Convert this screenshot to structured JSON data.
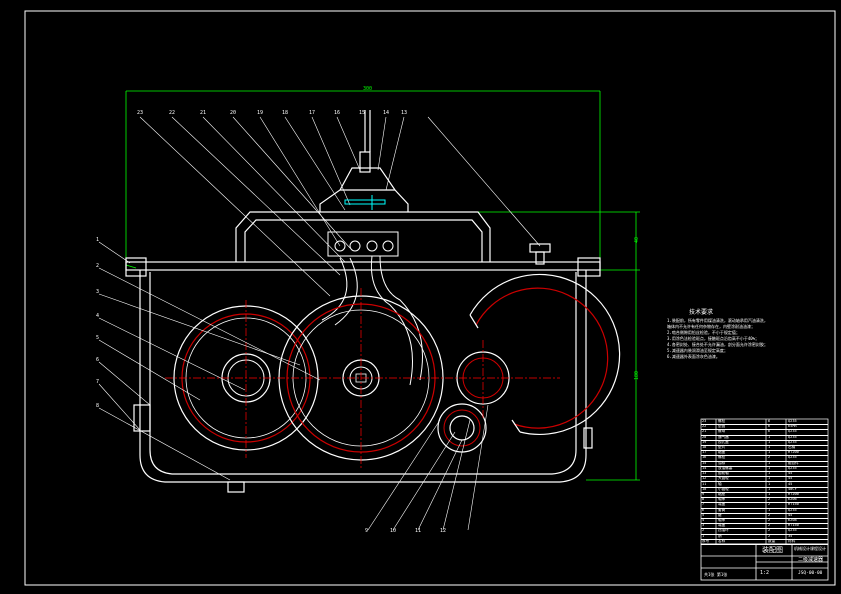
{
  "drawing": {
    "colors": {
      "background": "#000000",
      "outline": "#ffffff",
      "dimension": "#00ff00",
      "centerline": "#ff0000",
      "gear_pitch": "#cc0000",
      "leader": "#ffffff",
      "accent": "#00ffff",
      "hatch": "#ff00ff"
    },
    "top_dimension": "300",
    "right_dimensions": [
      "40",
      "180"
    ],
    "top_balloons": [
      "23",
      "22",
      "21",
      "20",
      "19",
      "18",
      "17",
      "16",
      "15",
      "14",
      "13"
    ],
    "left_balloons": [
      "1",
      "2",
      "3",
      "4",
      "5",
      "6",
      "7",
      "8"
    ],
    "bottom_balloons": [
      "9",
      "10",
      "11",
      "12"
    ],
    "technical_requirements": {
      "title": "技术要求",
      "lines": [
        "1.装配前，所有零件用煤油清洗，滚动轴承用汽油清洗，",
        "  箱体内不允许有任何杂物存在，内壁涂耐油油漆；",
        "2.啮合侧隙用铅丝检验，不小于规定值；",
        "3.用涂色法检验斑点，接触斑点沿齿高不小于40%；",
        "4.各密封处、接合处不允许漏油，剖分面允许涂密封胶；",
        "5.减速器内装润滑油至规定高度；",
        "6.减速器外表面涂灰色油漆。"
      ]
    },
    "title_block": {
      "drawing_name": "装配图",
      "company": "机械设计课程设计",
      "part_name": "二级减速器",
      "drawing_no": "JSQ-00-00",
      "scale": "1:2",
      "sheet": "共1张 第1张"
    },
    "parts_list": {
      "rows": [
        [
          "23",
          "螺栓",
          "6",
          "Q235"
        ],
        [
          "22",
          "垫圈",
          "6",
          "65Mn"
        ],
        [
          "21",
          "螺母",
          "6",
          "Q235"
        ],
        [
          "20",
          "通气器",
          "1",
          "Q235"
        ],
        [
          "19",
          "视孔盖",
          "1",
          "Q235"
        ],
        [
          "18",
          "垫片",
          "1",
          "石棉"
        ],
        [
          "17",
          "箱盖",
          "1",
          "HT200"
        ],
        [
          "16",
          "螺栓",
          "2",
          "Q235"
        ],
        [
          "15",
          "油标",
          "1",
          "组合件"
        ],
        [
          "14",
          "放油螺塞",
          "1",
          "Q235"
        ],
        [
          "13",
          "齿轮轴",
          "1",
          "45"
        ],
        [
          "12",
          "大齿轮",
          "1",
          "45"
        ],
        [
          "11",
          "轴",
          "1",
          "45"
        ],
        [
          "10",
          "小齿轮",
          "1",
          "40Cr"
        ],
        [
          "9",
          "箱座",
          "1",
          "HT200"
        ],
        [
          "8",
          "轴承",
          "2",
          "6206"
        ],
        [
          "7",
          "端盖",
          "2",
          "HT150"
        ],
        [
          "6",
          "套筒",
          "1",
          "Q235"
        ],
        [
          "5",
          "键",
          "2",
          "45"
        ],
        [
          "4",
          "轴承",
          "2",
          "6208"
        ],
        [
          "3",
          "端盖",
          "2",
          "HT150"
        ],
        [
          "2",
          "挡油环",
          "2",
          "Q235"
        ],
        [
          "1",
          "销",
          "2",
          "35"
        ]
      ],
      "header": [
        "序号",
        "名称",
        "数量",
        "材料"
      ]
    }
  }
}
